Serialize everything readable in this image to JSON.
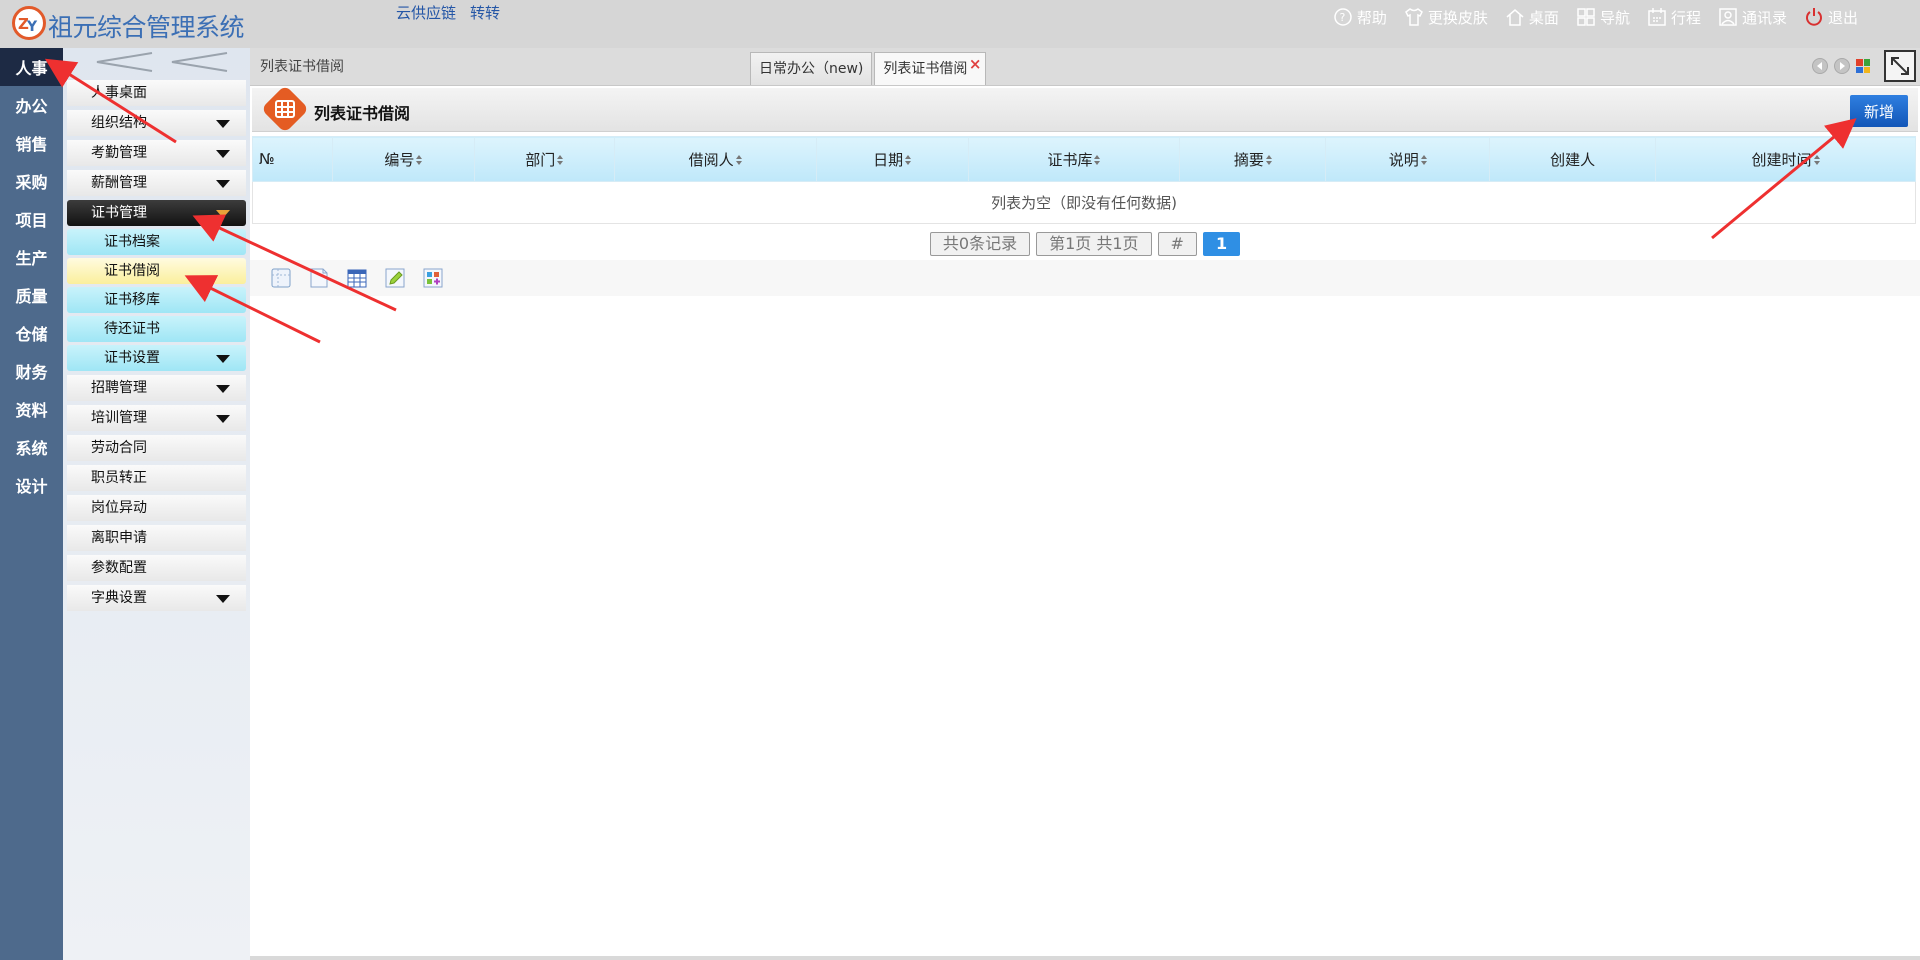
{
  "header": {
    "app_title": "祖元综合管理系统",
    "links": [
      "云供应链",
      "转转"
    ],
    "right_items": [
      {
        "icon": "help-icon",
        "label": "帮助"
      },
      {
        "icon": "tshirt-icon",
        "label": "更换皮肤"
      },
      {
        "icon": "home-icon",
        "label": "桌面"
      },
      {
        "icon": "grid-nav-icon",
        "label": "导航"
      },
      {
        "icon": "calendar-icon",
        "label": "行程"
      },
      {
        "icon": "contacts-icon",
        "label": "通讯录"
      },
      {
        "icon": "power-icon",
        "label": "退出"
      }
    ]
  },
  "modules": [
    "人事",
    "办公",
    "销售",
    "采购",
    "项目",
    "生产",
    "质量",
    "仓储",
    "财务",
    "资料",
    "系统",
    "设计"
  ],
  "active_module": "人事",
  "submenu": {
    "items_before": [
      {
        "label": "人事桌面",
        "has_caret": false
      },
      {
        "label": "组织结构",
        "has_caret": true
      },
      {
        "label": "考勤管理",
        "has_caret": true
      },
      {
        "label": "薪酬管理",
        "has_caret": true
      }
    ],
    "active_group": "证书管理",
    "sub_items": [
      {
        "label": "证书档案",
        "selected": false,
        "has_caret": false
      },
      {
        "label": "证书借阅",
        "selected": true,
        "has_caret": false
      },
      {
        "label": "证书移库",
        "selected": false,
        "has_caret": false
      },
      {
        "label": "待还证书",
        "selected": false,
        "has_caret": false
      },
      {
        "label": "证书设置",
        "selected": false,
        "has_caret": true
      }
    ],
    "items_after": [
      {
        "label": "招聘管理",
        "has_caret": true
      },
      {
        "label": "培训管理",
        "has_caret": true
      },
      {
        "label": "劳动合同",
        "has_caret": false
      },
      {
        "label": "职员转正",
        "has_caret": false
      },
      {
        "label": "岗位异动",
        "has_caret": false
      },
      {
        "label": "离职申请",
        "has_caret": false
      },
      {
        "label": "参数配置",
        "has_caret": false
      },
      {
        "label": "字典设置",
        "has_caret": true
      }
    ]
  },
  "breadcrumb": "列表证书借阅",
  "tabs": [
    {
      "label": "日常办公（new)",
      "active": false
    },
    {
      "label": "列表证书借阅",
      "active": true
    }
  ],
  "tab_close_glyph": "×",
  "panel": {
    "title": "列表证书借阅",
    "add_label": "新增"
  },
  "table": {
    "columns": [
      {
        "label": "№",
        "sortable": false,
        "width": 80
      },
      {
        "label": "编号",
        "sortable": true,
        "width": 142
      },
      {
        "label": "部门",
        "sortable": true,
        "width": 140
      },
      {
        "label": "借阅人",
        "sortable": true,
        "width": 202
      },
      {
        "label": "日期",
        "sortable": true,
        "width": 152
      },
      {
        "label": "证书库",
        "sortable": true,
        "width": 212
      },
      {
        "label": "摘要",
        "sortable": true,
        "width": 146
      },
      {
        "label": "说明",
        "sortable": true,
        "width": 164
      },
      {
        "label": "创建人",
        "sortable": false,
        "width": 166
      },
      {
        "label": "创建时间",
        "sortable": true,
        "width": 260
      }
    ],
    "empty_text": "列表为空（即没有任何数据)"
  },
  "pager": {
    "total": "共0条记录",
    "page_info": "第1页 共1页",
    "jump": "#",
    "current": "1"
  },
  "colors": {
    "module_bg": "#4e6a8c",
    "accent_orange": "#e45c23",
    "primary_blue": "#1256b8"
  }
}
